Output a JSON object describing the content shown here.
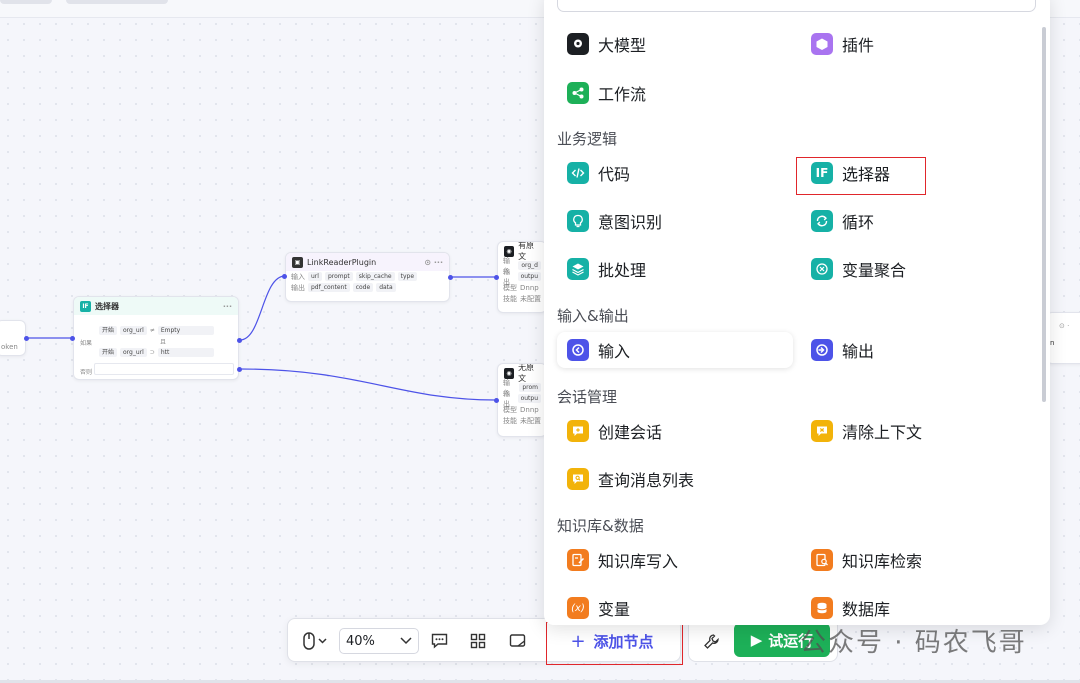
{
  "canvas": {
    "left_node": {
      "label": "oken"
    },
    "selector_node": {
      "title": "选择器",
      "more": "···",
      "cond_label": "如果",
      "cond1": {
        "src": "开始",
        "var": "org_url",
        "op": "≠",
        "val": "Empty"
      },
      "join": "且",
      "cond2": {
        "src": "开始",
        "var": "org_url",
        "op": "⊃",
        "val": "htt"
      },
      "else_label": "否则"
    },
    "plugin_node": {
      "title": "LinkReaderPlugin",
      "in_label": "输入",
      "inputs": [
        "url",
        "prompt",
        "skip_cache",
        "type"
      ],
      "out_label": "输出",
      "outputs": [
        "pdf_content",
        "code",
        "data"
      ]
    },
    "model_node1": {
      "title": "有原文",
      "r1_label": "输入",
      "r1_val": "org_d",
      "r2_label": "输出",
      "r2_val": "outpu",
      "r3_label": "模型",
      "r3_val": "Dnnp",
      "r4_label": "技能",
      "r4_val": "未配置"
    },
    "model_node2": {
      "title": "无原文",
      "r1_label": "输入",
      "r1_val": "prom",
      "r2_label": "输出",
      "r2_val": "outpu",
      "r3_label": "模型",
      "r3_val": "Dnnp",
      "r4_label": "技能",
      "r4_val": "未配置"
    },
    "right_node": {
      "label": "n"
    }
  },
  "toolbar": {
    "zoom": "40%",
    "add_node": "添加节点",
    "run": "试运行"
  },
  "panel": {
    "top_items": [
      {
        "label": "大模型",
        "color": "#1c1f23"
      },
      {
        "label": "插件",
        "color": "#a974f0"
      },
      {
        "label": "工作流",
        "color": "#1db058"
      }
    ],
    "sections": {
      "logic": "业务逻辑",
      "io": "输入&输出",
      "session": "会话管理",
      "kb": "知识库&数据"
    },
    "logic_items": [
      {
        "label": "代码",
        "color": "#16b1a6"
      },
      {
        "label": "选择器",
        "color": "#16b1a6"
      },
      {
        "label": "意图识别",
        "color": "#16b1a6"
      },
      {
        "label": "循环",
        "color": "#16b1a6"
      },
      {
        "label": "批处理",
        "color": "#16b1a6"
      },
      {
        "label": "变量聚合",
        "color": "#16b1a6"
      }
    ],
    "io_items": [
      {
        "label": "输入",
        "color": "#4d53e8"
      },
      {
        "label": "输出",
        "color": "#4d53e8"
      }
    ],
    "session_items": [
      {
        "label": "创建会话",
        "color": "#f2b30a"
      },
      {
        "label": "清除上下文",
        "color": "#f2b30a"
      },
      {
        "label": "查询消息列表",
        "color": "#f2b30a"
      }
    ],
    "kb_items": [
      {
        "label": "知识库写入",
        "color": "#f27c1f"
      },
      {
        "label": "知识库检索",
        "color": "#f27c1f"
      },
      {
        "label": "变量",
        "color": "#f27c1f"
      },
      {
        "label": "数据库",
        "color": "#f27c1f"
      }
    ]
  },
  "watermark": "公众号 · 码农飞哥"
}
